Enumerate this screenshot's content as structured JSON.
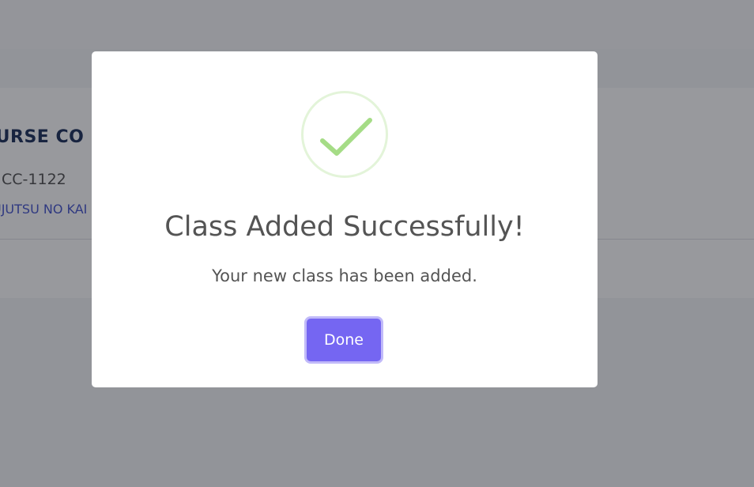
{
  "background": {
    "course_title": "CURSE CO",
    "course_code": "CC-1122",
    "course_name": "UJUTSU NO KAI"
  },
  "modal": {
    "icon": "check-circle-icon",
    "title": "Class Added Successfully!",
    "text": "Your new class has been added.",
    "done_label": "Done"
  },
  "colors": {
    "accent": "#7566f2",
    "success": "#a5dc86",
    "success_ring": "#e3f4d9",
    "heading": "#0b1f4d",
    "link": "#3748c9",
    "text": "#545454"
  }
}
